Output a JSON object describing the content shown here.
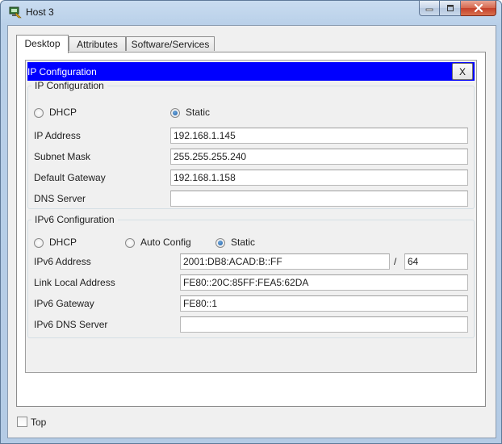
{
  "window": {
    "title": "Host 3"
  },
  "tabs": [
    {
      "label": "Desktop",
      "active": true
    },
    {
      "label": "Attributes",
      "active": false
    },
    {
      "label": "Software/Services",
      "active": false
    }
  ],
  "ip_panel": {
    "header_title": "IP Configuration",
    "close_label": "X"
  },
  "ipv4": {
    "legend": "IP Configuration",
    "mode_options": [
      {
        "label": "DHCP",
        "checked": false
      },
      {
        "label": "Static",
        "checked": true
      }
    ],
    "fields": {
      "ip_address": {
        "label": "IP Address",
        "value": "192.168.1.145"
      },
      "subnet_mask": {
        "label": "Subnet Mask",
        "value": "255.255.255.240"
      },
      "default_gateway": {
        "label": "Default Gateway",
        "value": "192.168.1.158"
      },
      "dns_server": {
        "label": "DNS Server",
        "value": ""
      }
    }
  },
  "ipv6": {
    "legend": "IPv6 Configuration",
    "mode_options": [
      {
        "label": "DHCP",
        "checked": false
      },
      {
        "label": "Auto Config",
        "checked": false
      },
      {
        "label": "Static",
        "checked": true
      }
    ],
    "fields": {
      "address": {
        "label": "IPv6 Address",
        "value": "2001:DB8:ACAD:B::FF",
        "prefix_separator": "/",
        "prefix": "64"
      },
      "link_local": {
        "label": "Link Local Address",
        "value": "FE80::20C:85FF:FEA5:62DA"
      },
      "gateway": {
        "label": "IPv6 Gateway",
        "value": "FE80::1"
      },
      "dns_server": {
        "label": "IPv6 DNS Server",
        "value": ""
      }
    }
  },
  "footer": {
    "top_checkbox_label": "Top",
    "top_checked": false
  },
  "icons": {
    "app": "packet-tracer-host-icon",
    "minimize": "minimize-icon",
    "maximize": "maximize-icon",
    "close": "close-icon"
  }
}
